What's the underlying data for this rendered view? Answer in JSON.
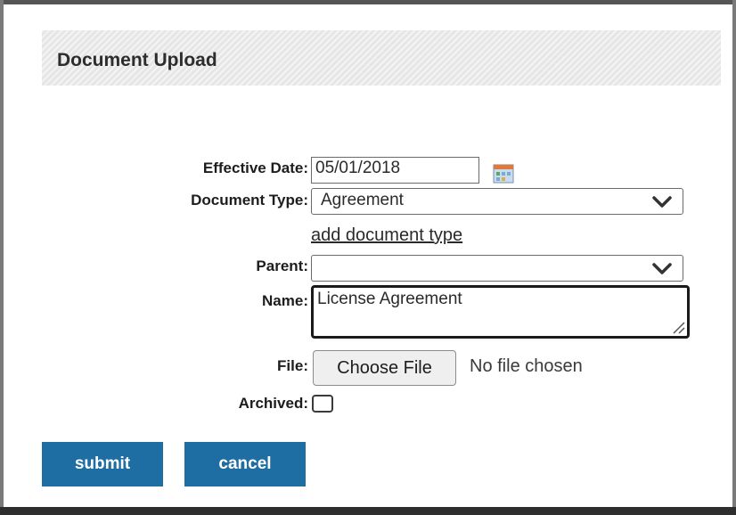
{
  "header": {
    "title": "Document Upload"
  },
  "form": {
    "effective_date": {
      "label": "Effective Date:",
      "value": "05/01/2018"
    },
    "document_type": {
      "label": "Document Type:",
      "selected": "Agreement",
      "add_link": "add document type"
    },
    "parent": {
      "label": "Parent:",
      "selected": ""
    },
    "name": {
      "label": "Name:",
      "value": "License Agreement"
    },
    "file": {
      "label": "File:",
      "button_label": "Choose File",
      "status": "No file chosen"
    },
    "archived": {
      "label": "Archived:",
      "checked": false
    }
  },
  "actions": {
    "submit_label": "submit",
    "cancel_label": "cancel"
  },
  "colors": {
    "button_bg": "#1f6ea3",
    "header_bg": "#e6e6e6"
  },
  "icons": {
    "calendar": "calendar-icon",
    "dropdown": "chevron-down-icon"
  }
}
